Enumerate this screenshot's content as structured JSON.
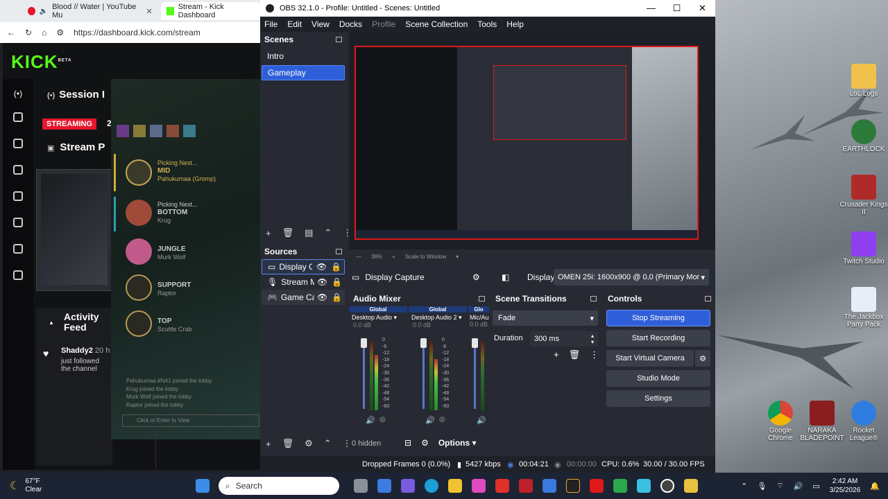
{
  "browser": {
    "tabs": [
      {
        "label": "Blood // Water | YouTube Mu"
      },
      {
        "label": "Stream - Kick Dashboard"
      }
    ],
    "url": "https://dashboard.kick.com/stream",
    "kick": {
      "logo": "KICK",
      "beta": "BETA",
      "session_title": "Session I",
      "status": "STREAMING",
      "status_num": "2",
      "stream_title": "Stream P",
      "activity_title": "Activity Feed",
      "feed_user": "Shaddy2",
      "feed_time": "20 h",
      "feed_text": "just followed the channel",
      "picks": [
        {
          "label": "Picking Next...",
          "role": "MID",
          "name": "Pahukumaa (Gromp)"
        },
        {
          "label": "Picking Next...",
          "role": "BOTTOM",
          "name": "Krug"
        },
        {
          "label": "",
          "role": "JUNGLE",
          "name": "Murk Wolf"
        },
        {
          "label": "",
          "role": "SUPPORT",
          "name": "Raptor"
        },
        {
          "label": "",
          "role": "TOP",
          "name": "Scuttle Crab"
        }
      ],
      "lobby_log": [
        "Pahukumaa #NA1 joined the lobby",
        "Krug joined the lobby",
        "Murk Wolf joined the lobby",
        "Raptor joined the lobby"
      ],
      "chat_hint": "Click or Enter to View",
      "colors": {
        "accent": "#53fc18",
        "streaming": "#e5162e"
      }
    }
  },
  "obs": {
    "title": "OBS 32.1.0 - Profile: Untitled - Scenes: Untitled",
    "menu": [
      "File",
      "Edit",
      "View",
      "Docks",
      "Profile",
      "Scene Collection",
      "Tools",
      "Help"
    ],
    "scenes_title": "Scenes",
    "scenes": [
      {
        "label": "Intro"
      },
      {
        "label": "Gameplay"
      }
    ],
    "sources_title": "Sources",
    "sources": [
      {
        "label": "Display Ca"
      },
      {
        "label": "Stream M"
      },
      {
        "label": "Game Cap"
      }
    ],
    "preview_zoom": "38%",
    "preview_scale": "Scale to Window",
    "source_bar": {
      "name": "Display Capture",
      "display_label": "Display",
      "display_value": "OMEN 25i: 1600x900 @ 0,0 (Primary Mor"
    },
    "mixer": {
      "title": "Audio Mixer",
      "channels": [
        {
          "scope": "Global",
          "name": "Desktop Audio",
          "db": "0.0 dB"
        },
        {
          "scope": "Global",
          "name": "Desktop Audio 2",
          "db": "0.0 dB"
        },
        {
          "scope": "Glo",
          "name": "Mic/Au",
          "db": "0.0 dB"
        }
      ],
      "scale": [
        "0",
        "-6",
        "-12",
        "-18",
        "-24",
        "-30",
        "-36",
        "-42",
        "-48",
        "-54",
        "-60"
      ],
      "hidden": "0 hidden",
      "options": "Options"
    },
    "transitions": {
      "title": "Scene Transitions",
      "type": "Fade",
      "duration_label": "Duration",
      "duration": "300 ms"
    },
    "controls": {
      "title": "Controls",
      "buttons": [
        "Stop Streaming",
        "Start Recording",
        "Start Virtual Camera",
        "Studio Mode",
        "Settings"
      ]
    },
    "status": {
      "dropped": "Dropped Frames 0 (0.0%)",
      "kbps": "5427 kbps",
      "stream_time": "00:04:21",
      "rec_time": "00:00:00",
      "cpu": "CPU: 0.6%",
      "fps": "30.00 / 30.00 FPS"
    }
  },
  "desktop": {
    "icons": [
      {
        "label": "LoL Logs"
      },
      {
        "label": "EARTHLOCK"
      },
      {
        "label": "Crusader Kings II"
      },
      {
        "label": "Twitch Studio"
      },
      {
        "label": "The Jackbox Party Pack"
      },
      {
        "label": "Google Chrome"
      },
      {
        "label": "NARAKA BLADEPOINT"
      },
      {
        "label": "Rocket League®"
      }
    ]
  },
  "taskbar": {
    "weather_temp": "67°F",
    "weather_cond": "Clear",
    "search": "Search",
    "time": "2:42 AM",
    "date": "3/25/2026"
  }
}
